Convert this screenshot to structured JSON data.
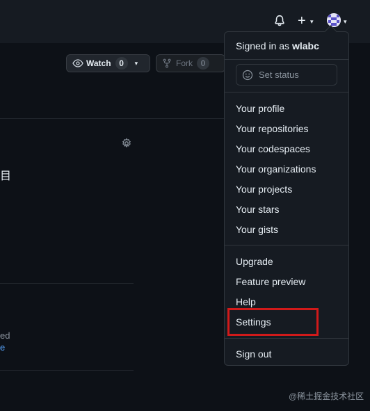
{
  "header": {
    "bell_icon": "bell-icon",
    "plus_label": "+",
    "caret": "▾"
  },
  "repo": {
    "watch_label": "Watch",
    "watch_count": "0",
    "fork_label": "Fork",
    "fork_count": "0",
    "partial_char": "目",
    "partial_ed": "ed",
    "partial_e": "e"
  },
  "menu": {
    "signed_in_prefix": "Signed in as ",
    "username": "wlabc",
    "set_status": "Set status",
    "group1": [
      "Your profile",
      "Your repositories",
      "Your codespaces",
      "Your organizations",
      "Your projects",
      "Your stars",
      "Your gists"
    ],
    "group2": [
      "Upgrade",
      "Feature preview",
      "Help",
      "Settings"
    ],
    "sign_out": "Sign out"
  },
  "watermark": "@稀土掘金技术社区",
  "colors": {
    "highlight": "#d11a1a",
    "link": "#58a6ff"
  }
}
